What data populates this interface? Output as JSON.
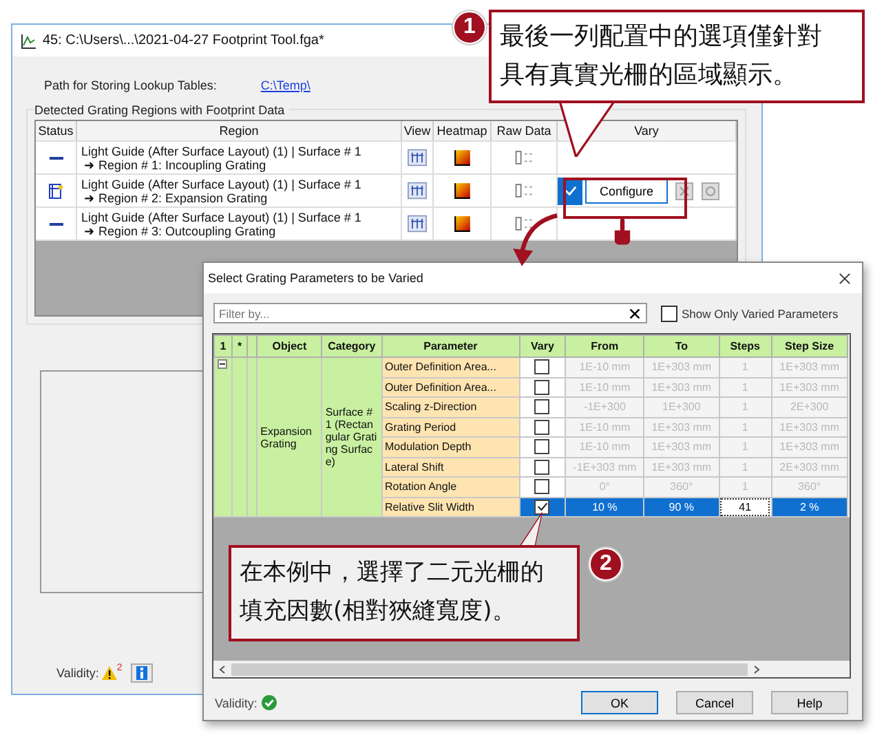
{
  "main_window": {
    "title": "45: C:\\Users\\...\\2021-04-27 Footprint Tool.fga*",
    "path_label": "Path for Storing Lookup Tables:",
    "path_link": "C:\\Temp\\",
    "group_title": "Detected Grating Regions with Footprint Data",
    "columns": [
      "Status",
      "Region",
      "View",
      "Heatmap",
      "Raw Data",
      "Vary"
    ],
    "rows": [
      {
        "kind": "none",
        "region": "Light Guide (After Surface Layout) (1) | Surface # 1",
        "subregion": "➜ Region # 1: Incoupling Grating",
        "vary": null
      },
      {
        "kind": "configured",
        "region": "Light Guide (After Surface Layout) (1) | Surface # 1",
        "subregion": "➜ Region # 2: Expansion Grating",
        "vary": {
          "checked": true,
          "button": "Configure"
        }
      },
      {
        "kind": "none",
        "region": "Light Guide (After Surface Layout) (1) | Surface # 1",
        "subregion": "➜ Region # 3: Outcoupling Grating",
        "vary": null
      }
    ],
    "validity_label": "Validity:",
    "warning_count": "2"
  },
  "dialog": {
    "title": "Select Grating Parameters to be Varied",
    "filter_placeholder": "Filter by...",
    "show_only_varied": {
      "label": "Show Only Varied Parameters",
      "checked": false
    },
    "columns": [
      "1",
      "*",
      "",
      "Object",
      "Category",
      "Parameter",
      "Vary",
      "From",
      "To",
      "Steps",
      "Step Size"
    ],
    "group": {
      "object": "Expansion Grating",
      "category": "Surface #1 (Rectangular Grating Surface)",
      "expanded": true
    },
    "rows": [
      {
        "parameter": "Outer Definition Area...",
        "vary": false,
        "from": "1E-10 mm",
        "to": "1E+303 mm",
        "steps": "1",
        "step_size": "1E+303 mm",
        "selected": false
      },
      {
        "parameter": "Outer Definition Area...",
        "vary": false,
        "from": "1E-10 mm",
        "to": "1E+303 mm",
        "steps": "1",
        "step_size": "1E+303 mm",
        "selected": false
      },
      {
        "parameter": "Scaling z-Direction",
        "vary": false,
        "from": "-1E+300",
        "to": "1E+300",
        "steps": "1",
        "step_size": "2E+300",
        "selected": false
      },
      {
        "parameter": "Grating Period",
        "vary": false,
        "from": "1E-10 mm",
        "to": "1E+303 mm",
        "steps": "1",
        "step_size": "1E+303 mm",
        "selected": false
      },
      {
        "parameter": "Modulation Depth",
        "vary": false,
        "from": "1E-10 mm",
        "to": "1E+303 mm",
        "steps": "1",
        "step_size": "1E+303 mm",
        "selected": false
      },
      {
        "parameter": "Lateral Shift",
        "vary": false,
        "from": "-1E+303 mm",
        "to": "1E+303 mm",
        "steps": "1",
        "step_size": "2E+303 mm",
        "selected": false
      },
      {
        "parameter": "Rotation Angle",
        "vary": false,
        "from": "0°",
        "to": "360°",
        "steps": "1",
        "step_size": "360°",
        "selected": false
      },
      {
        "parameter": "Relative Slit Width",
        "vary": true,
        "from": "10 %",
        "to": "90 %",
        "steps": "41",
        "step_size": "2 %",
        "selected": true
      }
    ],
    "validity_label": "Validity:",
    "buttons": [
      "OK",
      "Cancel",
      "Help"
    ]
  },
  "callouts": [
    {
      "number": "1",
      "text": "最後一列配置中的選項僅針對具有真實光柵的區域顯示。"
    },
    {
      "number": "2",
      "text": "在本例中，選擇了二元光柵的填充因數(相對狹縫寬度)。"
    }
  ]
}
